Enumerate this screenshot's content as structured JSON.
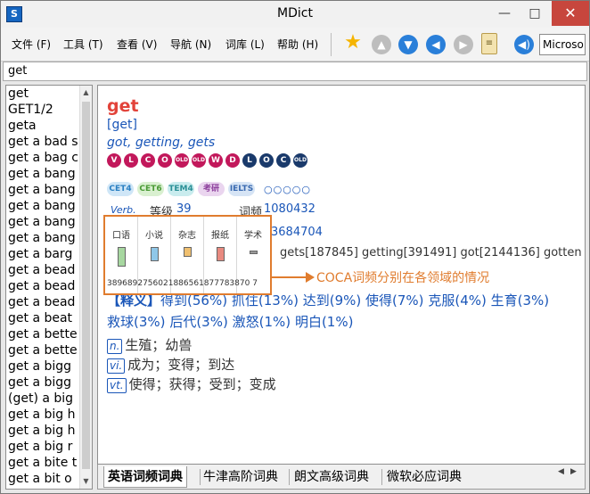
{
  "window": {
    "title": "MDict",
    "icon_letter": "S"
  },
  "menu": [
    {
      "label": "文件 (F)"
    },
    {
      "label": "工具 (T)"
    },
    {
      "label": "查看 (V)"
    },
    {
      "label": "导航 (N)"
    },
    {
      "label": "词库 (L)"
    },
    {
      "label": "帮助 (H)"
    }
  ],
  "toolbar": {
    "voice_value": "Microso"
  },
  "search": {
    "value": "get"
  },
  "word_list": [
    "get",
    "GET1/2",
    "geta",
    "get a bad s",
    "get a bag c",
    "get a bang",
    "get a bang",
    "get a bang",
    "get a bang",
    "get a bang",
    "get a barg",
    "get a bead",
    "get a bead",
    "get a bead",
    "get a beat",
    "get a bette",
    "get a bette",
    "get a bigg",
    "get a bigg",
    "(get) a big",
    "get a big h",
    "get a big h",
    "get a big r",
    "get a bite t",
    "get a bit o"
  ],
  "entry": {
    "headword": "get",
    "phonetic": "[get]",
    "inflections": "got, getting, gets",
    "dict_badges": [
      {
        "text": "V",
        "color": "#c2185b"
      },
      {
        "text": "L",
        "color": "#c2185b"
      },
      {
        "text": "C",
        "color": "#c2185b"
      },
      {
        "text": "O",
        "color": "#c2185b"
      },
      {
        "text": "OLD",
        "color": "#c2185b"
      },
      {
        "text": "OLD",
        "color": "#c2185b"
      },
      {
        "text": "W",
        "color": "#c2185b"
      },
      {
        "text": "D",
        "color": "#c2185b"
      },
      {
        "text": "L",
        "color": "#1a3a6b"
      },
      {
        "text": "O",
        "color": "#1a3a6b"
      },
      {
        "text": "C",
        "color": "#1a3a6b"
      },
      {
        "text": "OLD",
        "color": "#1a3a6b"
      }
    ],
    "exam_tags": [
      {
        "text": "CET4",
        "bg": "#cfe6f7",
        "fg": "#2a7fc2"
      },
      {
        "text": "CET6",
        "bg": "#d9f0d0",
        "fg": "#4a9a35"
      },
      {
        "text": "TEM4",
        "bg": "#c9ecee",
        "fg": "#2a8f96"
      },
      {
        "text": "考研",
        "bg": "#ead5ef",
        "fg": "#8a3a9a"
      },
      {
        "text": "IELTS",
        "bg": "#d6e4f5",
        "fg": "#3a6ab0"
      }
    ],
    "stars": "○○○○○",
    "pos_label": "Verb.",
    "rank_label": "等级",
    "rank_value": "39",
    "freq_label": "词频",
    "freq_value": "1080432",
    "second_number": "3684704",
    "forms": "gets[187845] getting[391491] got[2144136] gotten",
    "definitions": {
      "tag": "【释义】",
      "line1": [
        {
          "word": "得到",
          "pct": "(56%)"
        },
        {
          "word": "抓住",
          "pct": "(13%)"
        },
        {
          "word": "达到",
          "pct": "(9%)"
        },
        {
          "word": "使得",
          "pct": "(7%)"
        },
        {
          "word": "克服",
          "pct": "(4%)"
        },
        {
          "word": "生育",
          "pct": "(3%)"
        }
      ],
      "line2": [
        {
          "word": "救球",
          "pct": "(3%)"
        },
        {
          "word": "后代",
          "pct": "(3%)"
        },
        {
          "word": "激怒",
          "pct": "(1%)"
        },
        {
          "word": "明白",
          "pct": "(1%)"
        }
      ]
    },
    "senses": [
      {
        "pos": "n.",
        "text": "生殖；幼兽"
      },
      {
        "pos": "vi.",
        "text": "成为；变得；到达"
      },
      {
        "pos": "vt.",
        "text": "使得；获得；受到；变成"
      }
    ]
  },
  "coca": {
    "caption": "COCA词频分别在各领域的情况",
    "domains": [
      {
        "label": "口语",
        "value": "38968",
        "level": 0.55,
        "color": "#a7d7a0"
      },
      {
        "label": "小说",
        "value": "27560",
        "level": 0.39,
        "color": "#8fc7e8"
      },
      {
        "label": "杂志",
        "value": "21886",
        "level": 0.28,
        "color": "#f0c070"
      },
      {
        "label": "报纸",
        "value": "56187778",
        "level": 0.4,
        "color": "#e88a80"
      },
      {
        "label": "学术",
        "value": "38707",
        "level": 0.1,
        "color": "#999999"
      }
    ],
    "number_row": "3896892756021886561877783870 7"
  },
  "tabs": [
    {
      "label": "英语词频词典",
      "active": true
    },
    {
      "label": "牛津高阶词典",
      "active": false
    },
    {
      "label": "朗文高级词典",
      "active": false
    },
    {
      "label": "微软必应词典",
      "active": false
    }
  ]
}
